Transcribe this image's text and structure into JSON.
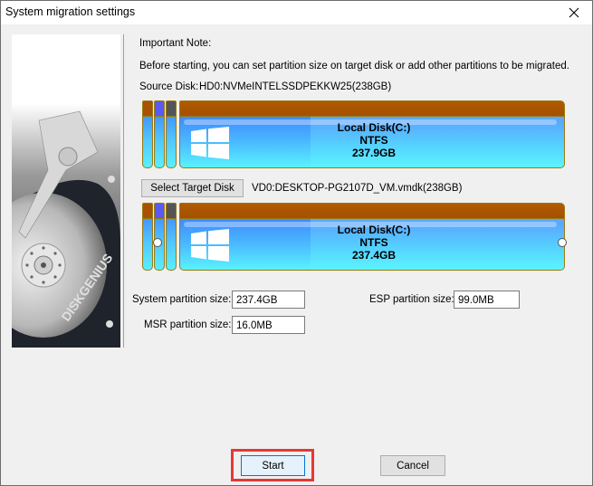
{
  "window": {
    "title": "System migration settings",
    "close_icon": "close-icon"
  },
  "sidebar": {
    "image": "diskgenius-hard-drive-illustration",
    "brand_text": "DISKGENIUS"
  },
  "note": {
    "heading": "Important Note:",
    "body": "Before starting, you can set partition size on target disk or add other partitions to be migrated."
  },
  "source": {
    "label": "Source Disk:",
    "value": "HD0:NVMeINTELSSDPEKKW25(238GB)",
    "small_partitions": [
      {
        "cap_color": "#a85200"
      },
      {
        "cap_color": "#5a5af0"
      },
      {
        "cap_color": "#555555"
      }
    ],
    "main_partition": {
      "name": "Local Disk(C:)",
      "fs": "NTFS",
      "size": "237.9GB",
      "icon": "windows-logo-icon"
    }
  },
  "target": {
    "select_button": "Select Target Disk",
    "value": "VD0:DESKTOP-PG2107D_VM.vmdk(238GB)",
    "small_partitions": [
      {
        "cap_color": "#a85200"
      },
      {
        "cap_color": "#5a5af0"
      },
      {
        "cap_color": "#555555"
      }
    ],
    "main_partition": {
      "name": "Local Disk(C:)",
      "fs": "NTFS",
      "size": "237.4GB",
      "icon": "windows-logo-icon"
    }
  },
  "fields": {
    "system_label": "System partition size:",
    "system_value": "237.4GB",
    "esp_label": "ESP partition size:",
    "esp_value": "99.0MB",
    "msr_label": "MSR partition size:",
    "msr_value": "16.0MB"
  },
  "buttons": {
    "start": "Start",
    "cancel": "Cancel"
  },
  "colors": {
    "partition_cap": "#a85200",
    "highlight": "#e53935",
    "focus_border": "#0078d7"
  }
}
